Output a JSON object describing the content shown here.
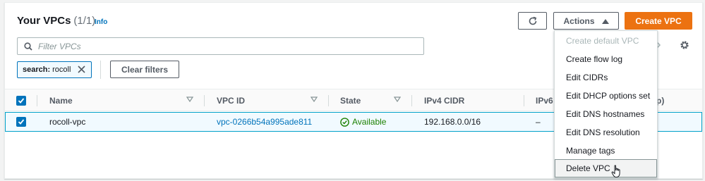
{
  "header": {
    "title": "Your VPCs",
    "count": "(1/1)",
    "info_link": "Info"
  },
  "toolbar": {
    "refresh_icon": "refresh-icon",
    "actions_label": "Actions",
    "create_label": "Create VPC"
  },
  "search": {
    "placeholder": "Filter VPCs",
    "value": ""
  },
  "filter_token": {
    "key": "search:",
    "value": "rocoll"
  },
  "clear_filters_label": "Clear filters",
  "table": {
    "columns": [
      "Name",
      "VPC ID",
      "State",
      "IPv4 CIDR",
      "IPv6",
      "p)"
    ],
    "rows": [
      {
        "name": "rocoll-vpc",
        "vpc_id": "vpc-0266b54a995ade811",
        "state": "Available",
        "ipv4_cidr": "192.168.0.0/16",
        "ipv6": "–"
      }
    ]
  },
  "actions_menu": {
    "items": [
      {
        "label": "Create default VPC",
        "disabled": true
      },
      {
        "label": "Create flow log",
        "disabled": false
      },
      {
        "label": "Edit CIDRs",
        "disabled": false
      },
      {
        "label": "Edit DHCP options set",
        "disabled": false
      },
      {
        "label": "Edit DNS hostnames",
        "disabled": false
      },
      {
        "label": "Edit DNS resolution",
        "disabled": false
      },
      {
        "label": "Manage tags",
        "disabled": false
      },
      {
        "label": "Delete VPC",
        "disabled": false,
        "hovered": true
      }
    ]
  },
  "colors": {
    "primary_button": "#ec7211",
    "link": "#0073bb",
    "success": "#1d8102"
  }
}
